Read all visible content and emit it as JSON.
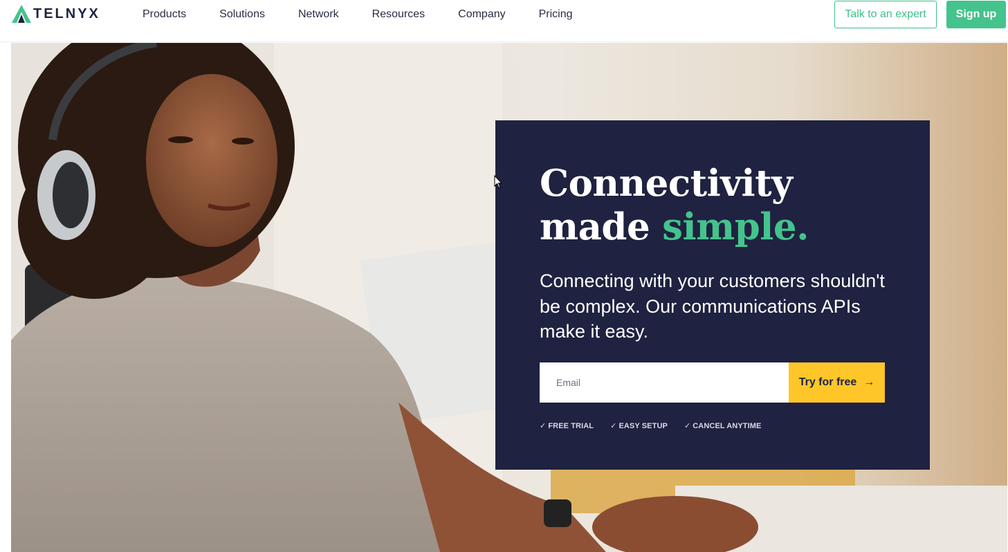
{
  "brand": {
    "name": "TELNYX",
    "accent_color": "#44c38d",
    "card_color": "#1f2240",
    "cta_color": "#ffc629"
  },
  "nav": {
    "items": [
      "Products",
      "Solutions",
      "Network",
      "Resources",
      "Company",
      "Pricing"
    ],
    "talk_label": "Talk to an expert",
    "signup_label": "Sign up"
  },
  "hero": {
    "headline_line1": "Connectivity",
    "headline_line2_plain": "made ",
    "headline_line2_accent": "simple.",
    "subtext": "Connecting with your customers shouldn't be complex. Our communications APIs make it easy.",
    "email_placeholder": "Email",
    "cta_label": "Try for free",
    "cta_icon": "arrow-right-icon",
    "features": [
      "FREE TRIAL",
      "EASY SETUP",
      "CANCEL ANYTIME"
    ],
    "feature_icon": "check-icon"
  }
}
